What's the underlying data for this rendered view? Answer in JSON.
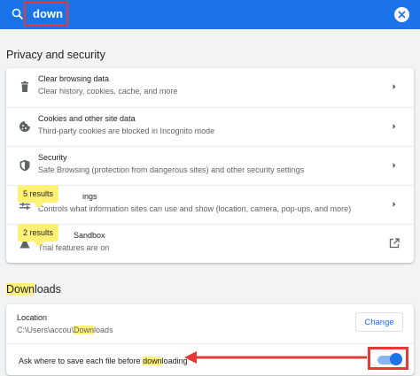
{
  "search": {
    "query": "down"
  },
  "privacy": {
    "title": "Privacy and security",
    "rows": [
      {
        "title": "Clear browsing data",
        "subtitle": "Clear history, cookies, cache, and more",
        "icon": "trash-icon"
      },
      {
        "title": "Cookies and other site data",
        "subtitle": "Third-party cookies are blocked in Incognito mode",
        "icon": "cookie-icon"
      },
      {
        "title": "Security",
        "subtitle": "Safe Browsing (protection from dangerous sites) and other security settings",
        "icon": "shield-icon"
      },
      {
        "title_visible": "ings",
        "subtitle": "Controls what information sites can use and show (location, camera, pop-ups, and more)",
        "icon": "sliders-icon"
      },
      {
        "title_visible": "Sandbox",
        "subtitle": "Trial features are on",
        "icon": "flask-icon"
      }
    ],
    "bubbles": [
      "5 results",
      "2 results"
    ]
  },
  "downloads": {
    "title_highlight": "Down",
    "title_rest": "loads",
    "location_label": "Location",
    "location_path_pre": "C:\\Users\\accou\\",
    "location_path_highlight": "Down",
    "location_path_post": "loads",
    "change_label": "Change",
    "ask_pre": "Ask where to save each file before ",
    "ask_highlight": "down",
    "ask_post": "loading",
    "ask_enabled": true
  },
  "colors": {
    "accent": "#1a73e8",
    "highlight": "#fff176",
    "annotation": "#e53935"
  }
}
